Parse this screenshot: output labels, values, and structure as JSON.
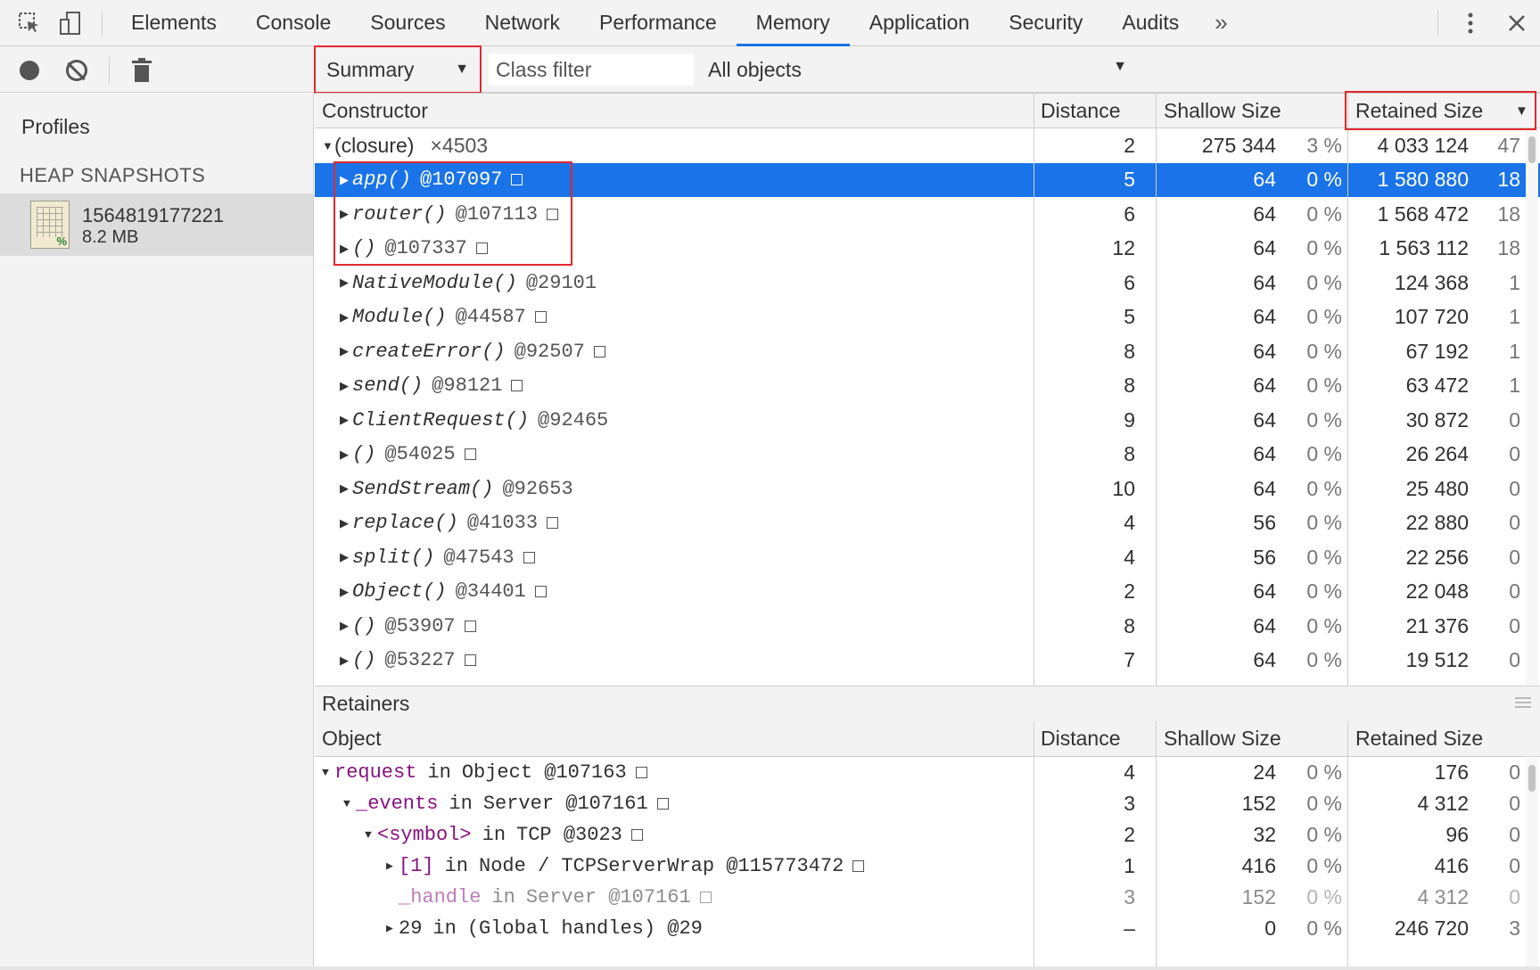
{
  "tabs": [
    {
      "label": "Elements",
      "active": false
    },
    {
      "label": "Console",
      "active": false
    },
    {
      "label": "Sources",
      "active": false
    },
    {
      "label": "Network",
      "active": false
    },
    {
      "label": "Performance",
      "active": false
    },
    {
      "label": "Memory",
      "active": true
    },
    {
      "label": "Application",
      "active": false
    },
    {
      "label": "Security",
      "active": false
    },
    {
      "label": "Audits",
      "active": false
    }
  ],
  "more_tabs": "»",
  "toolbar": {
    "view_select": "Summary",
    "class_filter_placeholder": "Class filter",
    "objects_select": "All objects"
  },
  "sidebar": {
    "title": "Profiles",
    "section": "HEAP SNAPSHOTS",
    "snapshot": {
      "name": "1564819177221",
      "size": "8.2 MB"
    }
  },
  "main_table": {
    "headers": [
      "Constructor",
      "Distance",
      "Shallow Size",
      "Retained Size"
    ],
    "sort_indicator": "▼",
    "group": {
      "name": "(closure)",
      "count": "×4503",
      "distance": "2",
      "shallow": "275 344",
      "shallow_pct": "3 %",
      "retained": "4 033 124",
      "retained_pct": "47"
    },
    "rows": [
      {
        "name": "app()",
        "id": "@107097",
        "box": true,
        "distance": "5",
        "shallow": "64",
        "shallow_pct": "0 %",
        "retained": "1 580 880",
        "retained_pct": "18",
        "selected": true
      },
      {
        "name": "router()",
        "id": "@107113",
        "box": true,
        "distance": "6",
        "shallow": "64",
        "shallow_pct": "0 %",
        "retained": "1 568 472",
        "retained_pct": "18"
      },
      {
        "name": "()",
        "id": "@107337",
        "box": true,
        "distance": "12",
        "shallow": "64",
        "shallow_pct": "0 %",
        "retained": "1 563 112",
        "retained_pct": "18"
      },
      {
        "name": "NativeModule()",
        "id": "@29101",
        "box": false,
        "distance": "6",
        "shallow": "64",
        "shallow_pct": "0 %",
        "retained": "124 368",
        "retained_pct": "1"
      },
      {
        "name": "Module()",
        "id": "@44587",
        "box": true,
        "distance": "5",
        "shallow": "64",
        "shallow_pct": "0 %",
        "retained": "107 720",
        "retained_pct": "1"
      },
      {
        "name": "createError()",
        "id": "@92507",
        "box": true,
        "distance": "8",
        "shallow": "64",
        "shallow_pct": "0 %",
        "retained": "67 192",
        "retained_pct": "1"
      },
      {
        "name": "send()",
        "id": "@98121",
        "box": true,
        "distance": "8",
        "shallow": "64",
        "shallow_pct": "0 %",
        "retained": "63 472",
        "retained_pct": "1"
      },
      {
        "name": "ClientRequest()",
        "id": "@92465",
        "box": false,
        "distance": "9",
        "shallow": "64",
        "shallow_pct": "0 %",
        "retained": "30 872",
        "retained_pct": "0"
      },
      {
        "name": "()",
        "id": "@54025",
        "box": true,
        "distance": "8",
        "shallow": "64",
        "shallow_pct": "0 %",
        "retained": "26 264",
        "retained_pct": "0"
      },
      {
        "name": "SendStream()",
        "id": "@92653",
        "box": false,
        "distance": "10",
        "shallow": "64",
        "shallow_pct": "0 %",
        "retained": "25 480",
        "retained_pct": "0"
      },
      {
        "name": "replace()",
        "id": "@41033",
        "box": true,
        "distance": "4",
        "shallow": "56",
        "shallow_pct": "0 %",
        "retained": "22 880",
        "retained_pct": "0"
      },
      {
        "name": "split()",
        "id": "@47543",
        "box": true,
        "distance": "4",
        "shallow": "56",
        "shallow_pct": "0 %",
        "retained": "22 256",
        "retained_pct": "0"
      },
      {
        "name": "Object()",
        "id": "@34401",
        "box": true,
        "distance": "2",
        "shallow": "64",
        "shallow_pct": "0 %",
        "retained": "22 048",
        "retained_pct": "0"
      },
      {
        "name": "()",
        "id": "@53907",
        "box": true,
        "distance": "8",
        "shallow": "64",
        "shallow_pct": "0 %",
        "retained": "21 376",
        "retained_pct": "0"
      },
      {
        "name": "()",
        "id": "@53227",
        "box": true,
        "distance": "7",
        "shallow": "64",
        "shallow_pct": "0 %",
        "retained": "19 512",
        "retained_pct": "0"
      }
    ]
  },
  "retainers": {
    "title": "Retainers",
    "headers": [
      "Object",
      "Distance",
      "Shallow Size",
      "Retained Size"
    ],
    "rows": [
      {
        "indent": 0,
        "arrow": "▼",
        "prop": "request",
        "in": "in",
        "obj": "Object @107163",
        "box": true,
        "distance": "4",
        "shallow": "24",
        "shallow_pct": "0 %",
        "retained": "176",
        "retained_pct": "0"
      },
      {
        "indent": 1,
        "arrow": "▼",
        "prop": "_events",
        "in": "in",
        "obj": "Server @107161",
        "box": true,
        "distance": "3",
        "shallow": "152",
        "shallow_pct": "0 %",
        "retained": "4 312",
        "retained_pct": "0"
      },
      {
        "indent": 2,
        "arrow": "▼",
        "prop": "<symbol>",
        "in": "in",
        "obj": "TCP @3023",
        "box": true,
        "distance": "2",
        "shallow": "32",
        "shallow_pct": "0 %",
        "retained": "96",
        "retained_pct": "0"
      },
      {
        "indent": 3,
        "arrow": "▶",
        "prop": "[1]",
        "in": "in",
        "obj": "Node / TCPServerWrap @115773472",
        "box": true,
        "distance": "1",
        "shallow": "416",
        "shallow_pct": "0 %",
        "retained": "416",
        "retained_pct": "0"
      },
      {
        "indent": 3,
        "arrow": "",
        "prop": "_handle",
        "in": "in",
        "obj": "Server @107161",
        "box": true,
        "faded": true,
        "distance": "3",
        "shallow": "152",
        "shallow_pct": "0 %",
        "retained": "4 312",
        "retained_pct": "0"
      },
      {
        "indent": 3,
        "arrow": "▶",
        "prop": "29",
        "in": "in",
        "obj": "(Global handles) @29",
        "box": false,
        "plain": true,
        "distance": "–",
        "shallow": "0",
        "shallow_pct": "0 %",
        "retained": "246 720",
        "retained_pct": "3"
      }
    ]
  },
  "colors": {
    "accent": "#1a73e8",
    "highlight": "#e0282e",
    "keyword": "#881280"
  }
}
